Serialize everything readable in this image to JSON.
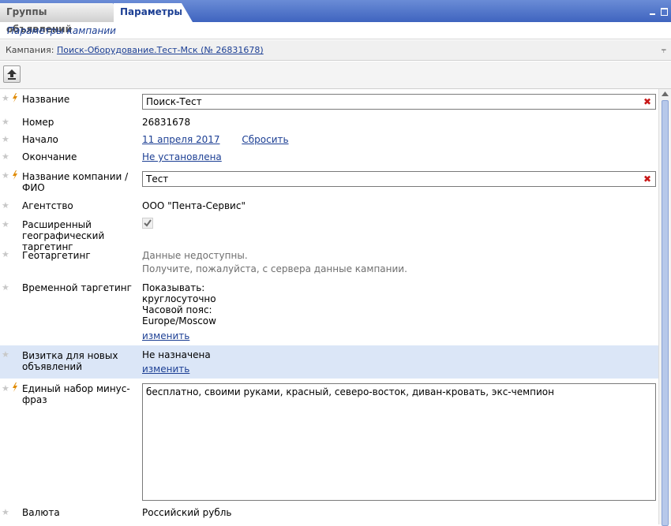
{
  "tabs": [
    {
      "label": "Группы объявлений",
      "active": false
    },
    {
      "label": "Параметры",
      "active": true
    }
  ],
  "subtitle": "Параметры кампании",
  "campaign": {
    "prefix": "Кампания:",
    "link": "Поиск-Оборудование.Тест-Мск (№ 26831678)"
  },
  "fields": {
    "name": {
      "label": "Название",
      "value": "Поиск-Тест"
    },
    "number": {
      "label": "Номер",
      "value": "26831678"
    },
    "start": {
      "label": "Начало",
      "value": "11 апреля 2017",
      "reset": "Сбросить"
    },
    "end": {
      "label": "Окончание",
      "value": "Не установлена"
    },
    "company": {
      "label": "Название компании / ФИО",
      "value": "Тест"
    },
    "agency": {
      "label": "Агентство",
      "value": "ООО \"Пента-Сервис\""
    },
    "geo_ext": {
      "label": "Расширенный географический таргетинг",
      "checked": true
    },
    "geo": {
      "label": "Геотаргетинг",
      "line1": "Данные недоступны.",
      "line2": "Получите, пожалуйста, с сервера данные кампании."
    },
    "time": {
      "label": "Временной таргетинг",
      "line1": "Показывать:",
      "line2": "круглосуточно",
      "line3": "Часовой пояс:",
      "line4": "Europe/Moscow",
      "change": "изменить"
    },
    "vcard": {
      "label": "Визитка для новых объявлений",
      "value": "Не назначена",
      "change": "изменить"
    },
    "minus": {
      "label": "Единый набор минус-фраз",
      "value": "бесплатно, своими руками, красный, северо-восток, диван-кровать, экс-чемпион"
    },
    "currency": {
      "label": "Валюта",
      "value": "Российский рубль"
    }
  },
  "icons": {
    "star": "star-icon",
    "bolt": "lightning-icon",
    "clear": "clear-icon",
    "upload": "upload-icon"
  },
  "colors": {
    "tab_bar": "#4d72c8",
    "link": "#1c3f94",
    "highlight_row": "#dbe6f7",
    "clear": "#c81818",
    "bolt": "#e08a00"
  }
}
